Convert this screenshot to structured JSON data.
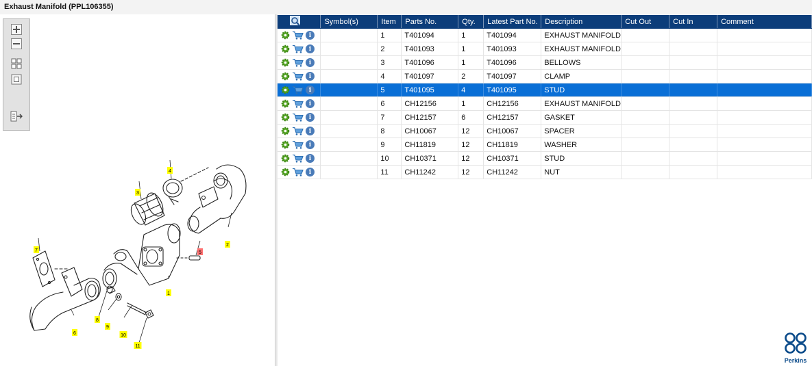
{
  "window": {
    "title": "Exhaust Manifold (PPL106355)"
  },
  "toolbar": {
    "buttons": [
      "zoom-in",
      "zoom-out",
      "fit-view",
      "actual-size",
      "export-panel"
    ]
  },
  "diagram": {
    "callouts": [
      {
        "label": "1",
        "highlighted": false
      },
      {
        "label": "2",
        "highlighted": false
      },
      {
        "label": "3",
        "highlighted": false
      },
      {
        "label": "4",
        "highlighted": false
      },
      {
        "label": "5",
        "highlighted": true
      },
      {
        "label": "6",
        "highlighted": false
      },
      {
        "label": "7",
        "highlighted": false
      },
      {
        "label": "8",
        "highlighted": false
      },
      {
        "label": "9",
        "highlighted": false
      },
      {
        "label": "10",
        "highlighted": false
      },
      {
        "label": "11",
        "highlighted": false
      }
    ],
    "colors": {
      "callout": "#ffff00",
      "callout_selected": "#ff7070"
    }
  },
  "grid": {
    "columns": [
      "",
      "Symbol(s)",
      "Item",
      "Parts No.",
      "Qty.",
      "Latest Part No.",
      "Description",
      "Cut Out",
      "Cut In",
      "Comment"
    ],
    "selected_item": "5",
    "rows": [
      {
        "symbol": "",
        "item": "1",
        "part_no": "T401094",
        "qty": "1",
        "latest_part_no": "T401094",
        "description": "EXHAUST MANIFOLD",
        "cut_out": "",
        "cut_in": "",
        "comment": ""
      },
      {
        "symbol": "",
        "item": "2",
        "part_no": "T401093",
        "qty": "1",
        "latest_part_no": "T401093",
        "description": "EXHAUST MANIFOLD",
        "cut_out": "",
        "cut_in": "",
        "comment": ""
      },
      {
        "symbol": "",
        "item": "3",
        "part_no": "T401096",
        "qty": "1",
        "latest_part_no": "T401096",
        "description": "BELLOWS",
        "cut_out": "",
        "cut_in": "",
        "comment": ""
      },
      {
        "symbol": "",
        "item": "4",
        "part_no": "T401097",
        "qty": "2",
        "latest_part_no": "T401097",
        "description": "CLAMP",
        "cut_out": "",
        "cut_in": "",
        "comment": ""
      },
      {
        "symbol": "",
        "item": "5",
        "part_no": "T401095",
        "qty": "4",
        "latest_part_no": "T401095",
        "description": "STUD",
        "cut_out": "",
        "cut_in": "",
        "comment": ""
      },
      {
        "symbol": "",
        "item": "6",
        "part_no": "CH12156",
        "qty": "1",
        "latest_part_no": "CH12156",
        "description": "EXHAUST MANIFOLD",
        "cut_out": "",
        "cut_in": "",
        "comment": ""
      },
      {
        "symbol": "",
        "item": "7",
        "part_no": "CH12157",
        "qty": "6",
        "latest_part_no": "CH12157",
        "description": "GASKET",
        "cut_out": "",
        "cut_in": "",
        "comment": ""
      },
      {
        "symbol": "",
        "item": "8",
        "part_no": "CH10067",
        "qty": "12",
        "latest_part_no": "CH10067",
        "description": "SPACER",
        "cut_out": "",
        "cut_in": "",
        "comment": ""
      },
      {
        "symbol": "",
        "item": "9",
        "part_no": "CH11819",
        "qty": "12",
        "latest_part_no": "CH11819",
        "description": "WASHER",
        "cut_out": "",
        "cut_in": "",
        "comment": ""
      },
      {
        "symbol": "",
        "item": "10",
        "part_no": "CH10371",
        "qty": "12",
        "latest_part_no": "CH10371",
        "description": "STUD",
        "cut_out": "",
        "cut_in": "",
        "comment": ""
      },
      {
        "symbol": "",
        "item": "11",
        "part_no": "CH11242",
        "qty": "12",
        "latest_part_no": "CH11242",
        "description": "NUT",
        "cut_out": "",
        "cut_in": "",
        "comment": ""
      }
    ],
    "row_icons": [
      "gear-icon",
      "cart-icon",
      "info-icon"
    ],
    "colors": {
      "header": "#0c3d7a",
      "selected_row": "#0a6fd6"
    }
  },
  "brand": {
    "name": "Perkins",
    "color": "#0b4b8a"
  }
}
